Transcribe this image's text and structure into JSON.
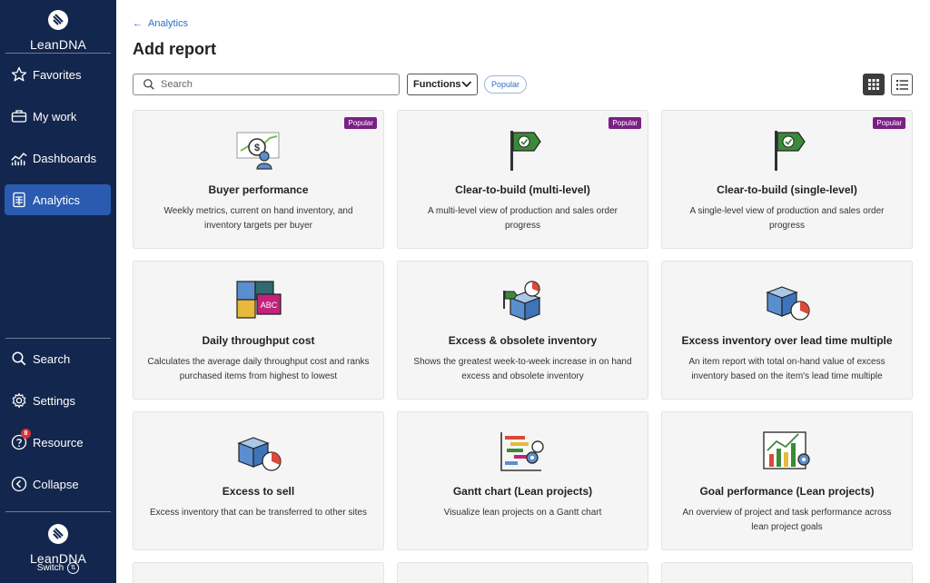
{
  "sidebar": {
    "brand": "LeanDNA",
    "nav_top": [
      {
        "label": "Favorites",
        "icon": "star-icon"
      },
      {
        "label": "My work",
        "icon": "briefcase-icon"
      },
      {
        "label": "Dashboards",
        "icon": "line-chart-icon"
      },
      {
        "label": "Analytics",
        "icon": "report-icon",
        "active": true
      }
    ],
    "nav_bottom": [
      {
        "label": "Search",
        "icon": "search-icon"
      },
      {
        "label": "Settings",
        "icon": "gear-icon"
      },
      {
        "label": "Resource",
        "icon": "help-icon",
        "badge": "8"
      },
      {
        "label": "Collapse",
        "icon": "chevron-left-icon"
      }
    ],
    "switch_label": "Switch"
  },
  "main": {
    "breadcrumb": "Analytics",
    "title": "Add report",
    "search_placeholder": "Search",
    "functions_label": "Functions",
    "popular_filter": "Popular",
    "colors": {
      "popular_tag": "#7b1f86",
      "accent": "#2a6fc9",
      "sidebar": "#13264d"
    }
  },
  "cards": [
    {
      "title": "Buyer performance",
      "desc": "Weekly metrics, current on hand inventory, and inventory targets per buyer",
      "tag": "Popular",
      "icon": "buyer-performance-icon"
    },
    {
      "title": "Clear-to-build (multi-level)",
      "desc": "A multi-level view of production and sales order progress",
      "tag": "Popular",
      "icon": "green-flag-icon"
    },
    {
      "title": "Clear-to-build (single-level)",
      "desc": "A single-level view of production and sales order progress",
      "tag": "Popular",
      "icon": "green-flag-icon"
    },
    {
      "title": "Daily throughput cost",
      "desc": "Calculates the average daily throughput cost and ranks purchased items from highest to lowest",
      "icon": "puzzle-icon",
      "icon_text": "ABC"
    },
    {
      "title": "Excess & obsolete inventory",
      "desc": "Shows the greatest week-to-week increase in on hand excess and obsolete inventory",
      "icon": "box-flag-clock-icon"
    },
    {
      "title": "Excess inventory over lead time multiple",
      "desc": "An item report with total on-hand value of excess inventory based on the item's lead time multiple",
      "icon": "box-clock-icon"
    },
    {
      "title": "Excess to sell",
      "desc": "Excess inventory that can be transferred to other sites",
      "icon": "box-clock-icon"
    },
    {
      "title": "Gantt chart (Lean projects)",
      "desc": "Visualize lean projects on a Gantt chart",
      "icon": "gantt-icon"
    },
    {
      "title": "Goal performance (Lean projects)",
      "desc": "An overview of project and task performance across lean project goals",
      "icon": "bar-growth-icon"
    }
  ]
}
